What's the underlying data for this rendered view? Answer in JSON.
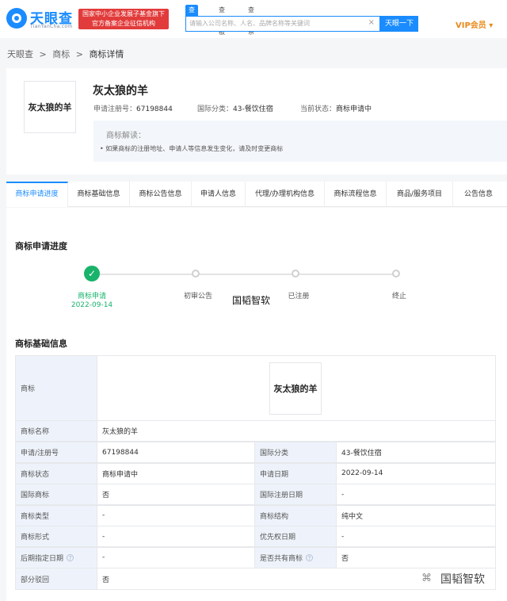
{
  "header": {
    "logo_text": "天眼查",
    "logo_sub": "TianYanCha.com",
    "badge_line1": "国家中小企业发展子基金旗下",
    "badge_line2": "官方备案企业征信机构",
    "search_tabs": [
      "查公司",
      "查老板",
      "查关系"
    ],
    "search_placeholder": "请输入公司名称、人名、品牌名称等关键词",
    "search_clear": "×",
    "search_button": "天眼一下",
    "vip": "VIP会员 ▾"
  },
  "breadcrumb": [
    "天眼查",
    ">",
    "商标",
    ">",
    "商标详情"
  ],
  "trademark": {
    "name": "灰太狼的羊",
    "reg_label": "申请注册号：",
    "reg_no": "67198844",
    "class_label": "国际分类：",
    "class_value": "43-餐饮住宿",
    "status_label": "当前状态：",
    "status_value": "商标申请中",
    "interp_title": "商标解读：",
    "interp_text": "• 如果商标的注册地址、申请人等信息发生变化，请及时变更商标"
  },
  "tabs": [
    "商标申请进度",
    "商标基础信息",
    "商标公告信息",
    "申请人信息",
    "代理/办理机构信息",
    "商标流程信息",
    "商品/服务项目",
    "公告信息"
  ],
  "progress": {
    "title": "商标申请进度",
    "steps": [
      {
        "label": "商标申请",
        "date": "2022-09-14"
      },
      {
        "label": "初审公告",
        "date": ""
      },
      {
        "label": "已注册",
        "date": ""
      },
      {
        "label": "终止",
        "date": ""
      }
    ]
  },
  "basic": {
    "title": "商标基础信息",
    "row_logo_label": "商标",
    "name_label": "商标名称",
    "name_value": "灰太狼的羊",
    "rows": [
      [
        "申请/注册号",
        "67198844",
        "国际分类",
        "43-餐饮住宿"
      ],
      [
        "商标状态",
        "商标申请中",
        "申请日期",
        "2022-09-14"
      ],
      [
        "国际商标",
        "否",
        "国际注册日期",
        "-"
      ],
      [
        "商标类型",
        "-",
        "商标结构",
        "纯中文"
      ],
      [
        "商标形式",
        "-",
        "优先权日期",
        "-"
      ],
      [
        "后期指定日期",
        "-",
        "是否共有商标",
        "否"
      ]
    ],
    "partial_label": "部分驳回",
    "partial_value": "否",
    "help_icon": "?"
  },
  "watermark": "国韬智软",
  "wechat_glyph": "⌘"
}
